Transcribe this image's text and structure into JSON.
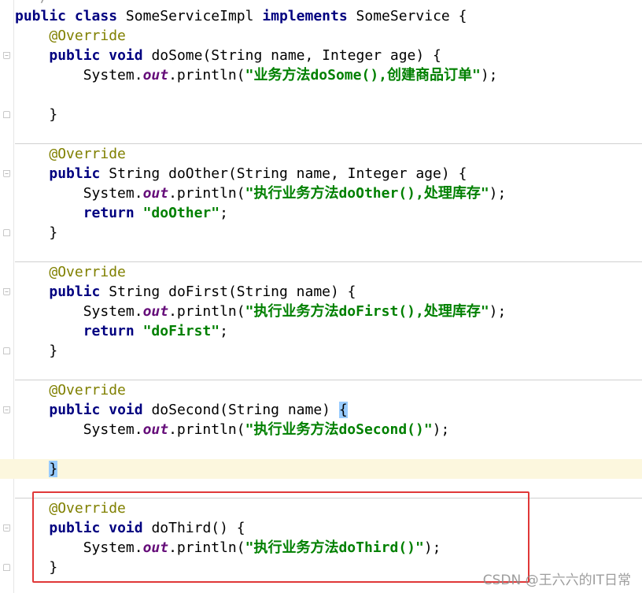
{
  "code": {
    "class_line": {
      "kw1": "public",
      "kw2": "class",
      "name": "SomeServiceImpl",
      "kw3": "implements",
      "iface": "SomeService {"
    },
    "methods": [
      {
        "annotation": "@Override",
        "sig_kw1": "public",
        "sig_type": "void",
        "sig_type_is_kw": true,
        "sig_rest": "doSome(String name, Integer age) {",
        "print_prefix": "System.",
        "print_field": "out",
        "print_mid": ".println(",
        "print_str": "\"业务方法doSome(),创建商品订单\"",
        "print_end": ");",
        "return_kw": "",
        "return_str": "",
        "close": "}"
      },
      {
        "annotation": "@Override",
        "sig_kw1": "public",
        "sig_type": "String",
        "sig_type_is_kw": false,
        "sig_rest": "doOther(String name, Integer age) {",
        "print_prefix": "System.",
        "print_field": "out",
        "print_mid": ".println(",
        "print_str": "\"执行业务方法doOther(),处理库存\"",
        "print_end": ");",
        "return_kw": "return",
        "return_str": "\"doOther\"",
        "close": "}"
      },
      {
        "annotation": "@Override",
        "sig_kw1": "public",
        "sig_type": "String",
        "sig_type_is_kw": false,
        "sig_rest": "doFirst(String name) {",
        "print_prefix": "System.",
        "print_field": "out",
        "print_mid": ".println(",
        "print_str": "\"执行业务方法doFirst(),处理库存\"",
        "print_end": ");",
        "return_kw": "return",
        "return_str": "\"doFirst\"",
        "close": "}"
      },
      {
        "annotation": "@Override",
        "sig_kw1": "public",
        "sig_type": "void",
        "sig_type_is_kw": true,
        "sig_rest": "doSecond(String name) ",
        "sig_brace": "{",
        "print_prefix": "System.",
        "print_field": "out",
        "print_mid": ".println(",
        "print_str": "\"执行业务方法doSecond()\"",
        "print_end": ");",
        "return_kw": "",
        "return_str": "",
        "close": "}"
      },
      {
        "annotation": "@Override",
        "sig_kw1": "public",
        "sig_type": "void",
        "sig_type_is_kw": true,
        "sig_rest": "doThird() {",
        "print_prefix": "System.",
        "print_field": "out",
        "print_mid": ".println(",
        "print_str": "\"执行业务方法doThird()\"",
        "print_end": ");",
        "return_kw": "",
        "return_str": "",
        "close": "}"
      }
    ],
    "semicolon": ";",
    "return_space": " "
  },
  "watermark": "CSDN @王六六的IT日常",
  "colors": {
    "keyword": "#000080",
    "annotation": "#808000",
    "string": "#008000",
    "field": "#660e7a",
    "highlight_box": "#e03838",
    "current_line": "#fcf7de",
    "brace_match": "#99ccff"
  }
}
